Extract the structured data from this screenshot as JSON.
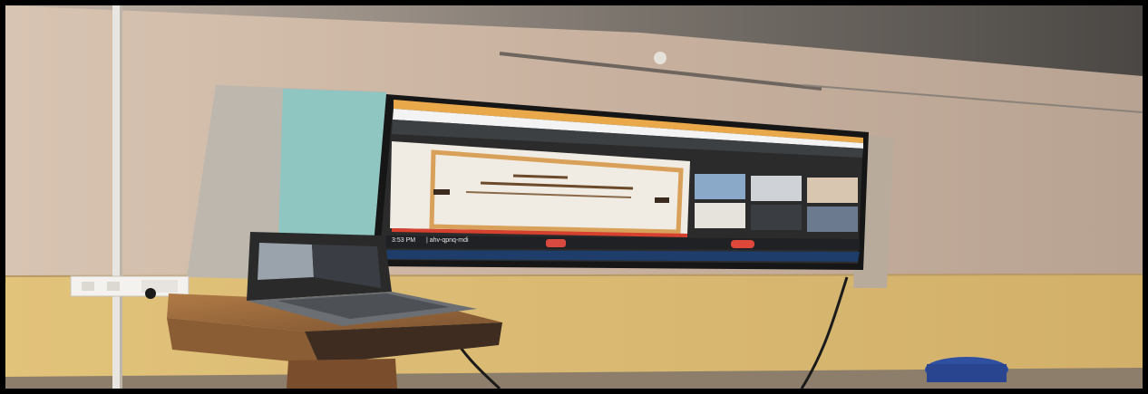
{
  "photo": {
    "subject": "classroom wall-mounted display showing a video conference",
    "colors": {
      "wall_upper": "#c9b29f",
      "wall_lower": "#d9b96f",
      "ceiling": "#5a5652",
      "panel_grey": "#bdb7ad",
      "panel_teal": "#8fc6c2",
      "tv_bezel": "#161616",
      "taskbar": "#1e3d6b",
      "slide_frame": "#d9a05a",
      "podium_wood": "#9a6a3e",
      "bucket": "#2f4fa0"
    }
  },
  "tv": {
    "meeting_toolbar": {
      "clock": "3:53 PM",
      "meeting_code": "| ahv-qpnq-mdi"
    },
    "participant_tiles": [
      {
        "tone": "#8aa9c9"
      },
      {
        "tone": "#cfd3d8"
      },
      {
        "tone": "#d9c6b0"
      },
      {
        "tone": "#e6e2dc"
      },
      {
        "tone": "#3a3d42"
      },
      {
        "tone": "#6b7a8e"
      }
    ]
  }
}
